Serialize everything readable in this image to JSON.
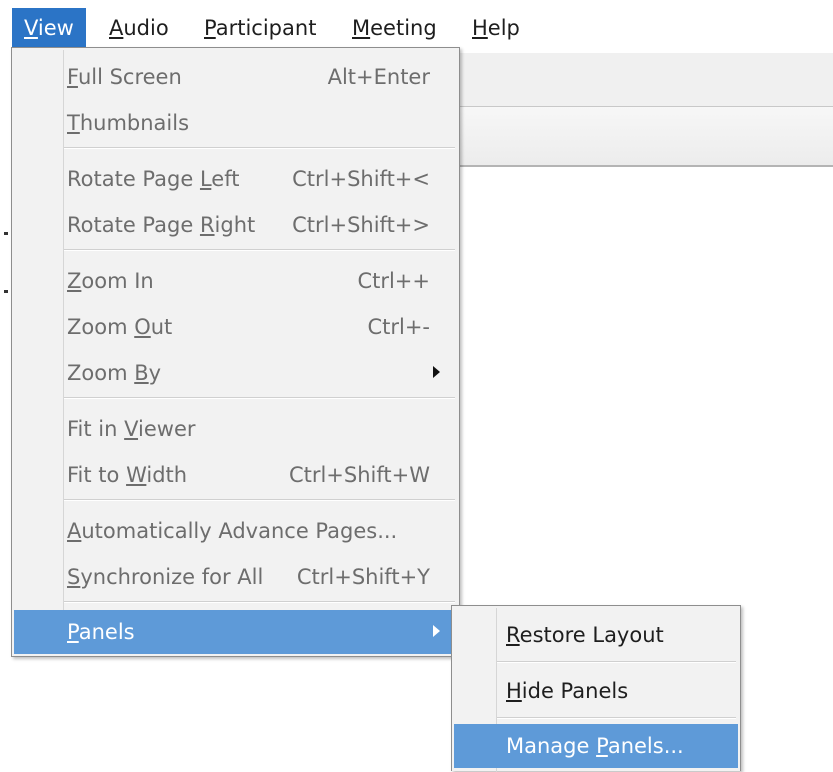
{
  "menubar": {
    "items": [
      {
        "mnemonic": "V",
        "rest": "iew"
      },
      {
        "mnemonic": "A",
        "rest": "udio"
      },
      {
        "mnemonic": "P",
        "rest": "articipant"
      },
      {
        "mnemonic": "M",
        "rest": "eeting"
      },
      {
        "mnemonic": "H",
        "rest": "elp"
      }
    ],
    "active_index": 0
  },
  "view_menu": {
    "full_screen": {
      "pre": "",
      "mn": "F",
      "post": "ull Screen",
      "shortcut": "Alt+Enter"
    },
    "thumbnails": {
      "pre": "",
      "mn": "T",
      "post": "humbnails",
      "shortcut": ""
    },
    "rotate_left": {
      "pre": "Rotate Page ",
      "mn": "L",
      "post": "eft",
      "shortcut": "Ctrl+Shift+<"
    },
    "rotate_right": {
      "pre": "Rotate Page ",
      "mn": "R",
      "post": "ight",
      "shortcut": "Ctrl+Shift+>"
    },
    "zoom_in": {
      "pre": "",
      "mn": "Z",
      "post": "oom In",
      "shortcut": "Ctrl++"
    },
    "zoom_out": {
      "pre": "Zoom ",
      "mn": "O",
      "post": "ut",
      "shortcut": "Ctrl+-"
    },
    "zoom_by": {
      "pre": "Zoom ",
      "mn": "B",
      "post": "y",
      "shortcut": ""
    },
    "fit_viewer": {
      "pre": "Fit in ",
      "mn": "V",
      "post": "iewer",
      "shortcut": ""
    },
    "fit_width": {
      "pre": "Fit to ",
      "mn": "W",
      "post": "idth",
      "shortcut": "Ctrl+Shift+W"
    },
    "auto_advance": {
      "pre": "",
      "mn": "A",
      "post": "utomatically Advance Pages...",
      "shortcut": ""
    },
    "synchronize": {
      "pre": "",
      "mn": "S",
      "post": "ynchronize for All",
      "shortcut": "Ctrl+Shift+Y"
    },
    "panels": {
      "pre": "",
      "mn": "P",
      "post": "anels",
      "shortcut": ""
    }
  },
  "panels_submenu": {
    "restore_layout": {
      "pre": "",
      "mn": "R",
      "post": "estore Layout"
    },
    "hide_panels": {
      "pre": "",
      "mn": "H",
      "post": "ide Panels"
    },
    "manage_panels": {
      "pre": "Manage ",
      "mn": "P",
      "post": "anels..."
    }
  },
  "colors": {
    "menubar_active": "#2b74c6",
    "menu_highlight": "#5e9ad8",
    "menu_background": "#f2f2f2",
    "disabled_text": "#6d6d6d"
  }
}
